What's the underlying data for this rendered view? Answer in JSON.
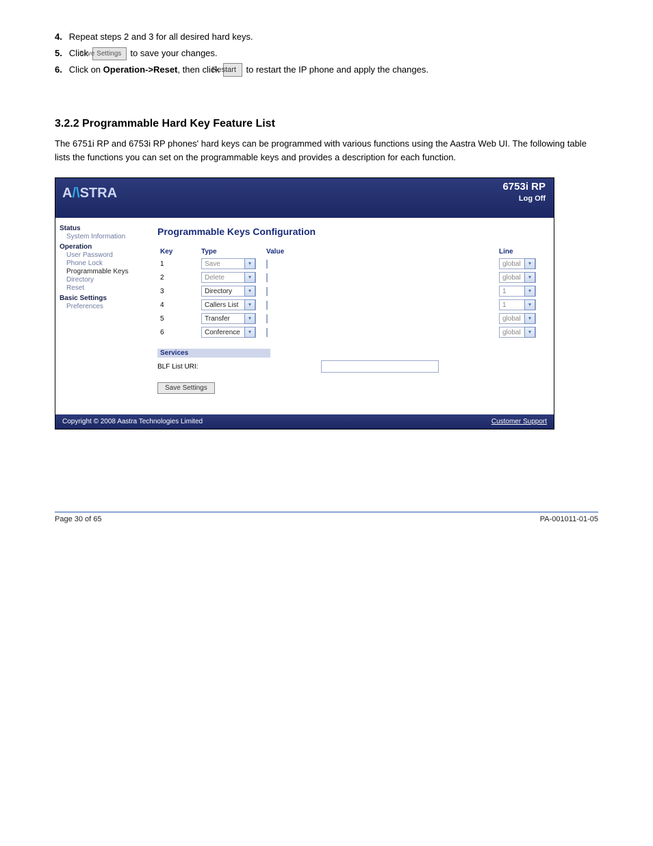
{
  "instructions": {
    "i4": {
      "num": "4.",
      "text": "Repeat steps 2 and 3 for all desired hard keys."
    },
    "i5": {
      "num": "5.",
      "prefix": "Click ",
      "btn": "Save Settings",
      "suffix": " to save your changes."
    },
    "i6": {
      "num": "6.",
      "prefix": "Click on ",
      "bold1": "Operation->Reset",
      "mid": ", then click ",
      "btn": "Restart",
      "suffix": " to restart the IP phone and apply the changes."
    }
  },
  "heading": "3.2.2 Programmable Hard Key Feature List",
  "para": "The 6751i RP and 6753i RP phones' hard keys can be programmed with various functions using the Aastra Web UI.  The following table lists the functions you can set on the programmable keys and provides a description for each function.",
  "shot": {
    "logo_parts": [
      "A",
      "/\\",
      "STRA"
    ],
    "model": "6753i RP",
    "logoff": "Log Off",
    "sidebar": {
      "status_head": "Status",
      "status_item": "System Information",
      "operation_head": "Operation",
      "op_items": [
        "User Password",
        "Phone Lock",
        "Programmable Keys",
        "Directory",
        "Reset"
      ],
      "basic_head": "Basic Settings",
      "basic_item": "Preferences"
    },
    "main_title": "Programmable Keys Configuration",
    "columns": {
      "key": "Key",
      "type": "Type",
      "value": "Value",
      "line": "Line"
    },
    "rows": [
      {
        "key": "1",
        "type": "Save",
        "type_disabled": true,
        "line": "global",
        "line_disabled": true
      },
      {
        "key": "2",
        "type": "Delete",
        "type_disabled": true,
        "line": "global",
        "line_disabled": true
      },
      {
        "key": "3",
        "type": "Directory",
        "type_disabled": false,
        "line": "1",
        "line_disabled": true
      },
      {
        "key": "4",
        "type": "Callers List",
        "type_disabled": false,
        "line": "1",
        "line_disabled": true
      },
      {
        "key": "5",
        "type": "Transfer",
        "type_disabled": false,
        "line": "global",
        "line_disabled": true
      },
      {
        "key": "6",
        "type": "Conference",
        "type_disabled": false,
        "line": "global",
        "line_disabled": true
      }
    ],
    "services_head": "Services",
    "blf_label": "BLF List URI:",
    "save_btn": "Save Settings",
    "footer_left": "Copyright © 2008 Aastra Technologies Limited",
    "footer_right": "Customer Support"
  },
  "page_footer": {
    "left": "Page 30 of 65",
    "right": "PA-001011-01-05"
  }
}
